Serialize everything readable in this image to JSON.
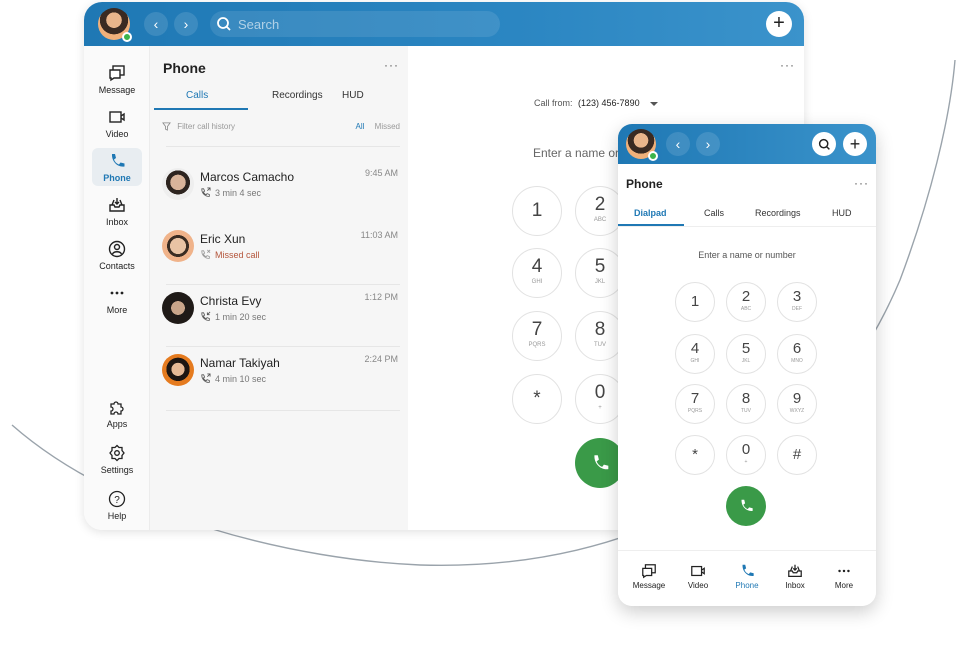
{
  "colors": {
    "brand_blue": "#1f78b4",
    "call_green": "#3a9a48",
    "missed_red": "#b4553b"
  },
  "desktop": {
    "search": {
      "placeholder": "Search"
    },
    "rail": {
      "items": [
        {
          "label": "Message",
          "icon": "message-icon"
        },
        {
          "label": "Video",
          "icon": "video-icon"
        },
        {
          "label": "Phone",
          "icon": "phone-icon",
          "active": true
        },
        {
          "label": "Inbox",
          "icon": "inbox-icon"
        },
        {
          "label": "Contacts",
          "icon": "contacts-icon"
        },
        {
          "label": "More",
          "icon": "more-icon"
        }
      ],
      "bottom_items": [
        {
          "label": "Apps",
          "icon": "apps-icon"
        },
        {
          "label": "Settings",
          "icon": "settings-icon"
        },
        {
          "label": "Help",
          "icon": "help-icon"
        }
      ]
    },
    "list_pane": {
      "title": "Phone",
      "more": "···",
      "tabs": [
        {
          "label": "Calls",
          "active": true
        },
        {
          "label": "Recordings"
        },
        {
          "label": "HUD"
        }
      ],
      "filter_placeholder": "Filter call history",
      "filter_all": "All",
      "filter_missed": "Missed",
      "calls": [
        {
          "name": "Marcos Camacho",
          "detail": "3 min 4 sec",
          "time": "9:45 AM",
          "missed": false
        },
        {
          "name": "Eric Xun",
          "detail": "Missed call",
          "time": "11:03 AM",
          "missed": true
        },
        {
          "name": "Christa Evy",
          "detail": "1 min 20 sec",
          "time": "1:12 PM",
          "missed": false
        },
        {
          "name": "Namar Takiyah",
          "detail": "4 min 10 sec",
          "time": "2:24 PM",
          "missed": false
        }
      ]
    },
    "dial_pane": {
      "more": "···",
      "call_from_label": "Call from:",
      "call_from_number": "(123) 456-7890",
      "enter_placeholder": "Enter a name or number",
      "keys": [
        {
          "d": "1",
          "s": ""
        },
        {
          "d": "2",
          "s": "ABC"
        },
        {
          "d": "4",
          "s": "GHI"
        },
        {
          "d": "5",
          "s": "JKL"
        },
        {
          "d": "7",
          "s": "PQRS"
        },
        {
          "d": "8",
          "s": "TUV"
        },
        {
          "d": "*",
          "s": ""
        },
        {
          "d": "0",
          "s": "+"
        }
      ]
    }
  },
  "mobile": {
    "title": "Phone",
    "more": "···",
    "tabs": [
      {
        "label": "Dialpad",
        "active": true
      },
      {
        "label": "Calls"
      },
      {
        "label": "Recordings"
      },
      {
        "label": "HUD"
      }
    ],
    "enter_placeholder": "Enter a name or number",
    "keys": [
      {
        "d": "1",
        "s": ""
      },
      {
        "d": "2",
        "s": "ABC"
      },
      {
        "d": "3",
        "s": "DEF"
      },
      {
        "d": "4",
        "s": "GHI"
      },
      {
        "d": "5",
        "s": "JKL"
      },
      {
        "d": "6",
        "s": "MNO"
      },
      {
        "d": "7",
        "s": "PQRS"
      },
      {
        "d": "8",
        "s": "TUV"
      },
      {
        "d": "9",
        "s": "WXYZ"
      },
      {
        "d": "*",
        "s": ""
      },
      {
        "d": "0",
        "s": "+"
      },
      {
        "d": "#",
        "s": ""
      }
    ],
    "bottom_nav": [
      {
        "label": "Message"
      },
      {
        "label": "Video"
      },
      {
        "label": "Phone",
        "active": true
      },
      {
        "label": "Inbox"
      },
      {
        "label": "More"
      }
    ]
  }
}
